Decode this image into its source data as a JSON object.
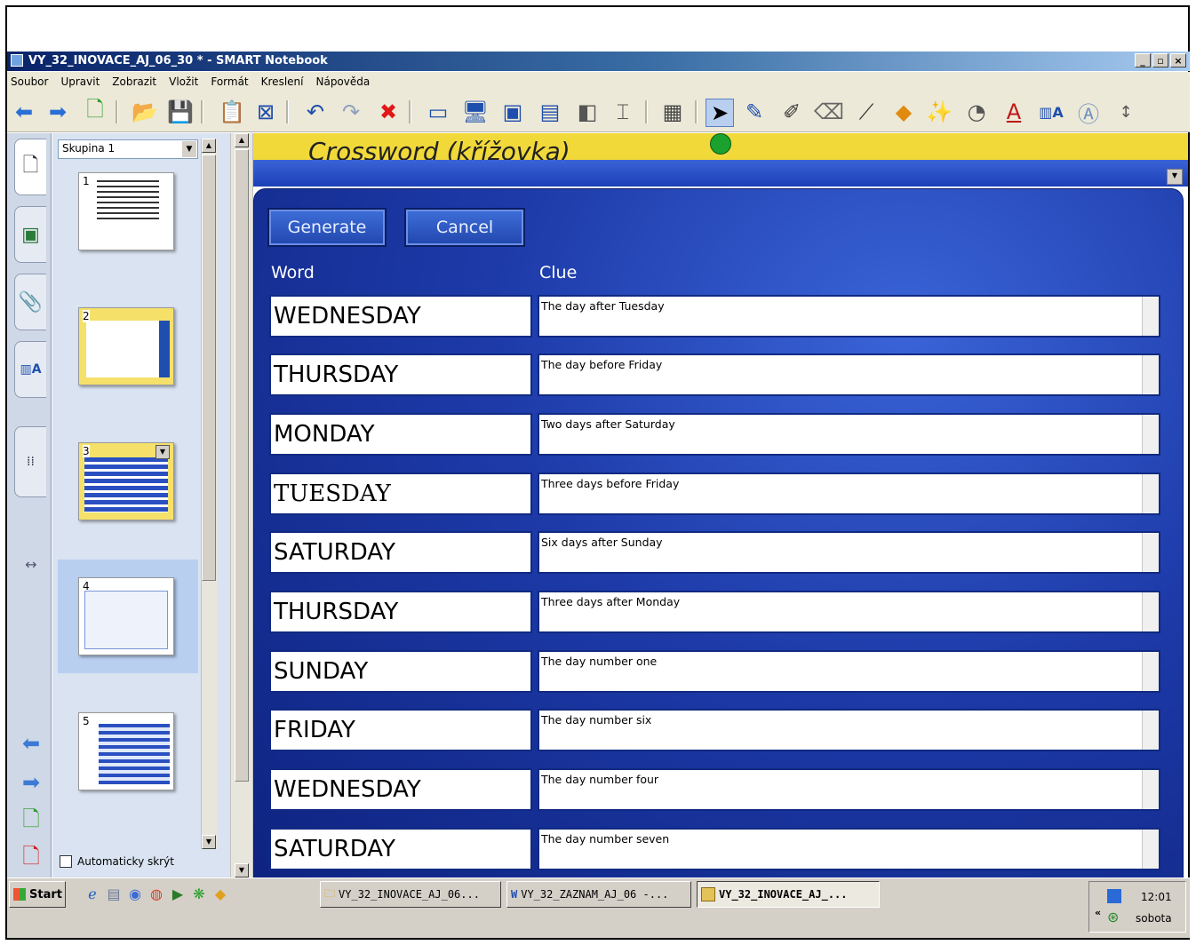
{
  "window": {
    "title": "VY_32_INOVACE_AJ_06_30 * - SMART Notebook",
    "controls": [
      "_",
      "▫",
      "×"
    ]
  },
  "menu": [
    "Soubor",
    "Upravit",
    "Zobrazit",
    "Vložit",
    "Formát",
    "Kreslení",
    "Nápověda"
  ],
  "toolbar_icons": [
    "back-icon",
    "forward-icon",
    "add-page-icon",
    "open-icon",
    "save-icon",
    "paste-icon",
    "delete-page-icon",
    "undo-icon",
    "redo-icon",
    "delete-icon",
    "screen-shade-icon",
    "full-screen-icon",
    "dual-page-icon",
    "capture-icon",
    "document-camera-icon",
    "toolbar-options-icon",
    "table-icon",
    "select-icon",
    "pen-icon",
    "creative-pen-icon",
    "eraser-icon",
    "line-icon",
    "shapes-icon",
    "magic-pen-icon",
    "fill-icon",
    "text-icon",
    "properties-icon",
    "recognize-icon",
    "move-toolbar-icon"
  ],
  "sorter": {
    "group": "Skupina 1",
    "pages": [
      "1",
      "2",
      "3",
      "4",
      "5"
    ],
    "selected_page": "3",
    "autohide_label": "Automaticky skrýt"
  },
  "canvas": {
    "title": "Crossword (křížovka)",
    "buttons": {
      "generate": "Generate",
      "cancel": "Cancel"
    },
    "col_word": "Word",
    "col_clue": "Clue",
    "rows": [
      {
        "word": "WEDNESDAY",
        "clue": "The day after Tuesday"
      },
      {
        "word": "THURSDAY",
        "clue": "The day before Friday"
      },
      {
        "word": "MONDAY",
        "clue": "Two days after Saturday"
      },
      {
        "word": "TUESDAY",
        "clue": "Three days before Friday"
      },
      {
        "word": "SATURDAY",
        "clue": "Six days after Sunday"
      },
      {
        "word": "THURSDAY",
        "clue": "Three days after Monday"
      },
      {
        "word": "SUNDAY",
        "clue": "The day number one"
      },
      {
        "word": "FRIDAY",
        "clue": "The day number six"
      },
      {
        "word": "WEDNESDAY",
        "clue": "The day number four"
      },
      {
        "word": "SATURDAY",
        "clue": "The day number seven"
      }
    ]
  },
  "taskbar": {
    "start": "Start",
    "tasks": [
      {
        "label": "VY_32_INOVACE_AJ_06...",
        "icon": "folder-icon"
      },
      {
        "label": "VY_32_ZAZNAM_AJ_06 -...",
        "icon": "word-icon"
      },
      {
        "label": "VY_32_INOVACE_AJ_...",
        "icon": "notebook-icon",
        "active": true
      }
    ],
    "clock": "12:01",
    "day": "sobota"
  },
  "colors": {
    "title_bar": "#0a246a",
    "panel_blue": "#1d3aa8",
    "title_band": "#f1d93a",
    "pin_green": "#1aa12e"
  }
}
